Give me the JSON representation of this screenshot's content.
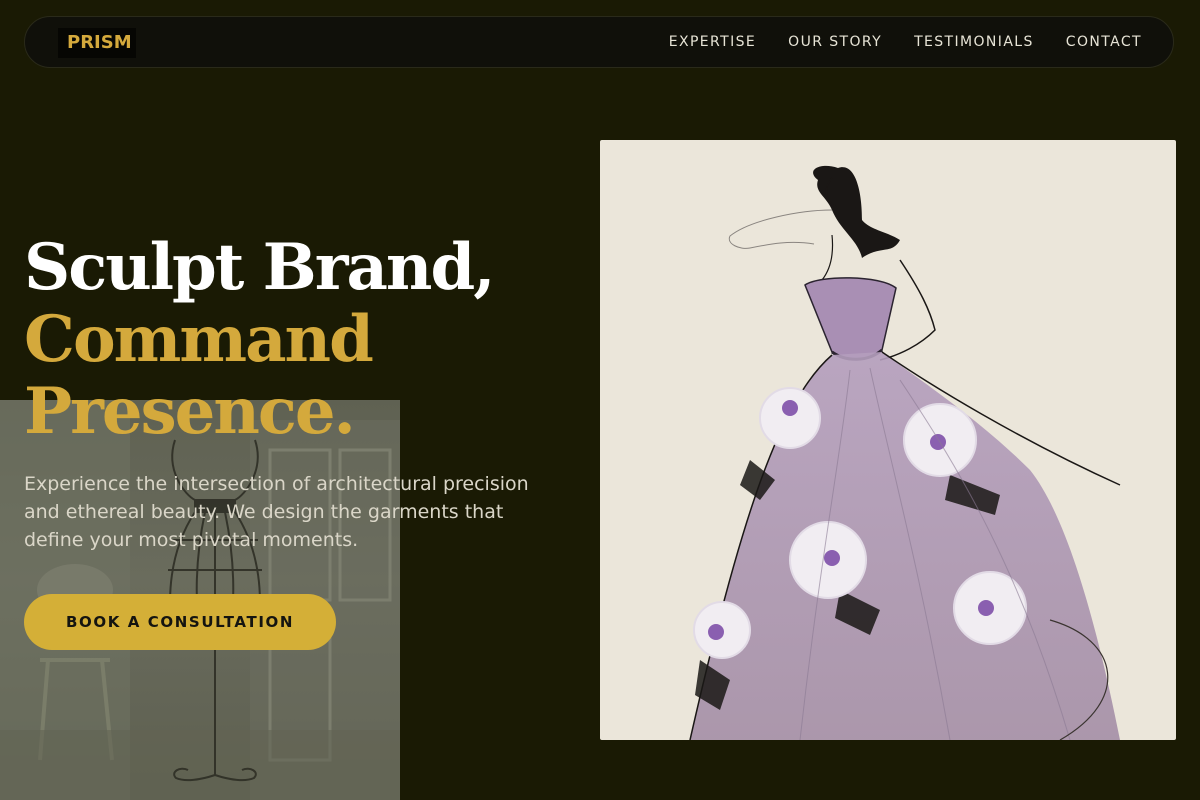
{
  "brand": {
    "logo_text": "PRISM",
    "accent_color": "#d4af37"
  },
  "nav": {
    "links": [
      {
        "label": "EXPERTISE"
      },
      {
        "label": "OUR STORY"
      },
      {
        "label": "TESTIMONIALS"
      },
      {
        "label": "CONTACT"
      }
    ]
  },
  "hero": {
    "headline_line1": "Sculpt Brand,",
    "headline_line2": "Command Presence.",
    "subtitle": "Experience the intersection of architectural precision and ethereal beauty. We design the garments that define your most pivotal moments.",
    "cta_label": "BOOK A CONSULTATION"
  },
  "images": {
    "background": "mannequin-photo",
    "feature": "gown-sketch-illustration"
  }
}
